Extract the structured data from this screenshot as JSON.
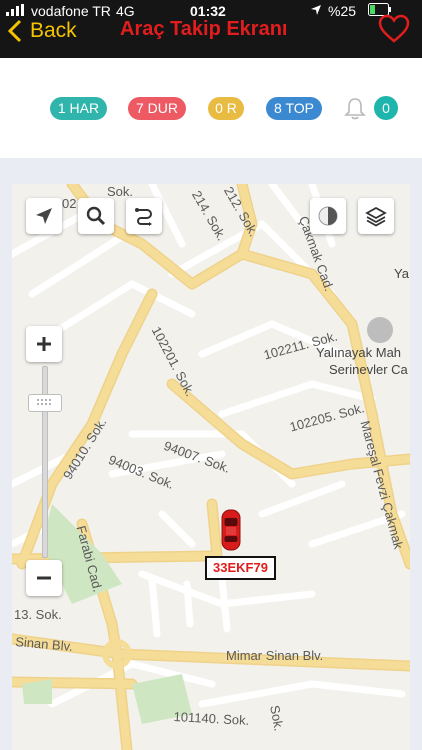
{
  "status": {
    "carrier": "vodafone TR",
    "network": "4G",
    "time": "01:32",
    "battery": "%25"
  },
  "header": {
    "back_label": "Back",
    "title": "Araç Takip Ekranı"
  },
  "counts": [
    {
      "label": "1 HAR",
      "color": "#2fb5ab"
    },
    {
      "label": "7 DUR",
      "color": "#ee5a63"
    },
    {
      "label": "0 R",
      "color": "#e8bb43"
    },
    {
      "label": "8 TOP",
      "color": "#3a89d1"
    }
  ],
  "alarm_count": "0",
  "map": {
    "streets": {
      "s1": "02",
      "s2": "Sok.",
      "s3": "214. Sok.",
      "s4": "212. Sok.",
      "s5": "Çakmak Cad.",
      "s6": "102201. Sok.",
      "s7": "102211. Sok.",
      "s8": "102205. Sok.",
      "s9": "94007. Sok.",
      "s10": "94010. Sok.",
      "s11": "94003. Sok.",
      "s12": "Mareşal Fevzi Çakmak",
      "s13": "Farabi Cad.",
      "s14": "13. Sok.",
      "s15": "Sinan Blv.",
      "s16": "Mimar Sinan Blv.",
      "s17": "101140. Sok.",
      "s18": "Sok.",
      "s19": "Yalınayak Mah",
      "s20": "Serinevler Ca",
      "s21": "Ya"
    },
    "vehicle_plate": "33EKF79"
  },
  "colors": {
    "accent": "#f5c400",
    "title_red": "#e11d1d",
    "road_main": "#f6dd97",
    "road_minor": "#ffffff"
  }
}
